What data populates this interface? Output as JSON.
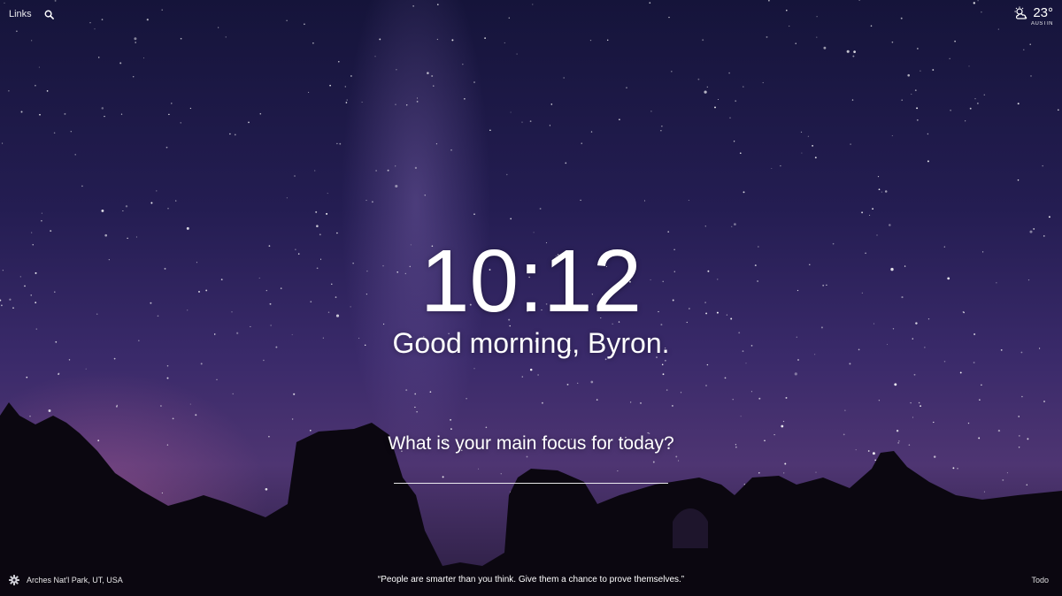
{
  "topbar": {
    "links_label": "Links",
    "search_icon": "search-icon"
  },
  "weather": {
    "icon": "partly-cloudy-icon",
    "temperature": "23°",
    "city": "AUSTIN"
  },
  "center": {
    "time": "10:12",
    "greeting": "Good morning, Byron.",
    "focus_question": "What is your main focus for today?",
    "focus_value": ""
  },
  "footer": {
    "settings_icon": "gear-icon",
    "location": "Arches Nat'l Park, UT, USA",
    "quote": "“People are smarter than you think. Give them a chance to prove themselves.”",
    "todo_label": "Todo"
  },
  "colors": {
    "sky_top": "#15143a",
    "sky_mid": "#3a2a6a",
    "horizon_glow": "#aa5a96",
    "silhouette": "#0b0710",
    "text": "#ffffff"
  }
}
